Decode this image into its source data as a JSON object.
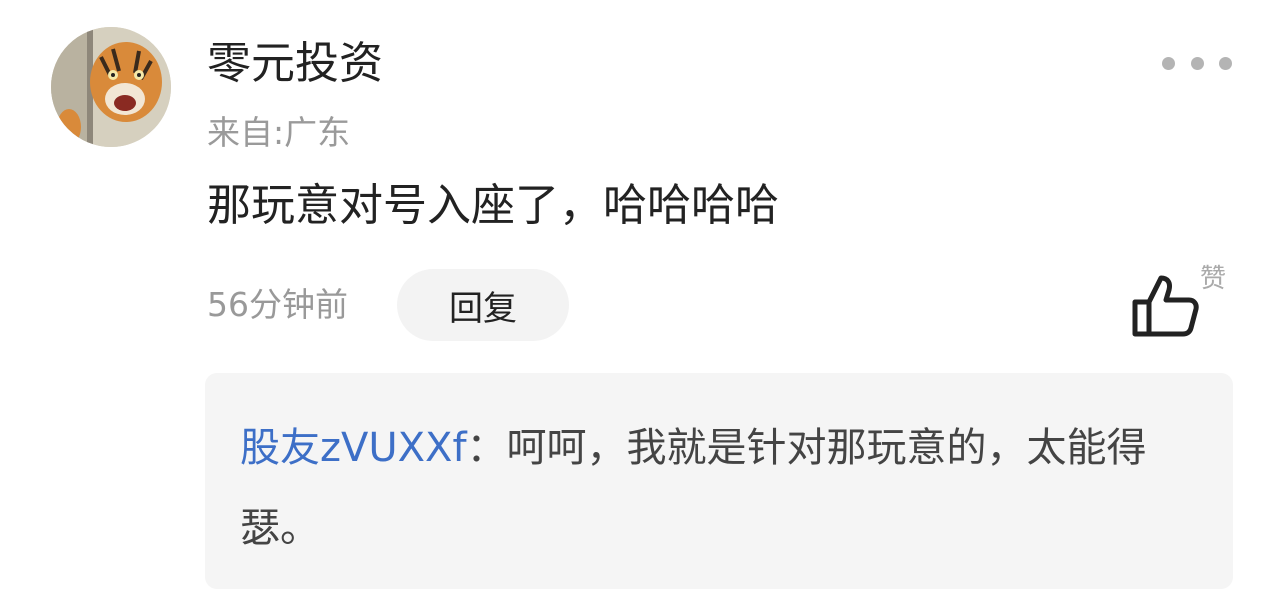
{
  "comment": {
    "avatar_icon": "tiger-avatar",
    "username": "零元投资",
    "location": "来自:广东",
    "text": "那玩意对号入座了，哈哈哈哈",
    "timestamp": "56分钟前",
    "reply_label": "回复",
    "like_label": "赞",
    "more_icon": "more-dots-icon",
    "like_icon": "thumbs-up-icon"
  },
  "reply": {
    "author": "股友zVUXXf",
    "separator": "：",
    "text": "呵呵，我就是针对那玩意的，太能得瑟。"
  },
  "colors": {
    "link_blue": "#3d6fc7",
    "text_dark": "#222222",
    "text_gray": "#999999",
    "reply_bg": "#f5f5f5"
  }
}
